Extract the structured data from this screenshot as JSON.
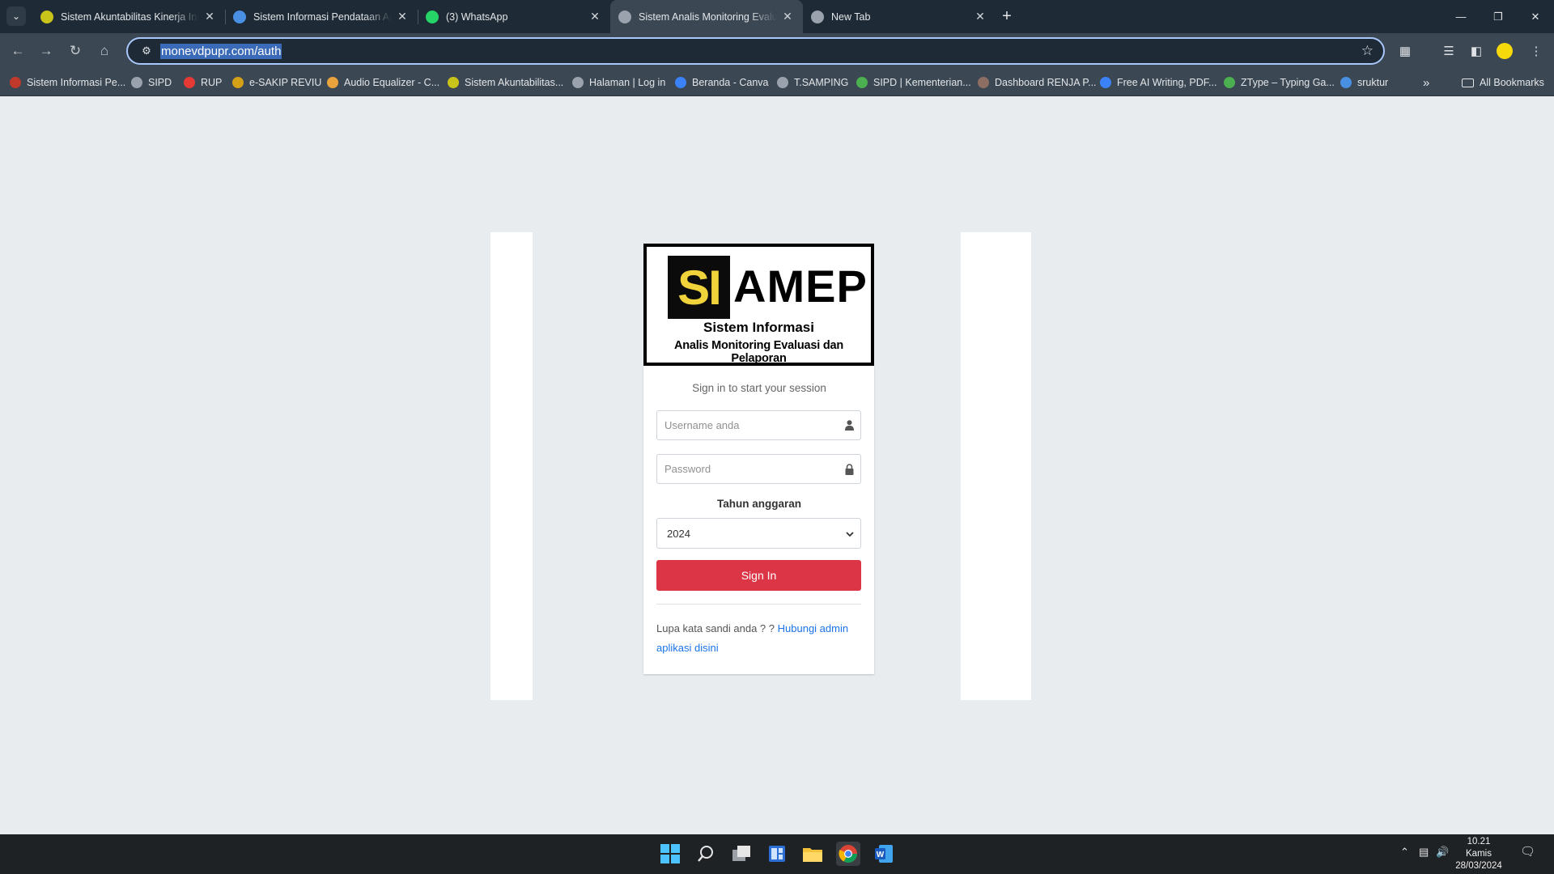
{
  "browser": {
    "tabs": [
      {
        "title": "Sistem Akuntabilitas Kinerja Ins",
        "active": false,
        "favicon_color": "#c9c41a"
      },
      {
        "title": "Sistem Informasi Pendataan Ap",
        "active": false,
        "favicon_color": "#4a90e2"
      },
      {
        "title": "(3) WhatsApp",
        "active": false,
        "favicon_color": "#25d366"
      },
      {
        "title": "Sistem Analis Monitoring Evalu",
        "active": true,
        "favicon_color": "#9aa3ad"
      },
      {
        "title": "New Tab",
        "active": false,
        "favicon_color": "#9aa3ad"
      }
    ],
    "url": "monevdpupr.com/auth",
    "bookmarks": [
      {
        "label": "Sistem Informasi Pe...",
        "color": "#c0392b"
      },
      {
        "label": "SIPD",
        "color": "#9aa3ad"
      },
      {
        "label": "RUP",
        "color": "#e53935"
      },
      {
        "label": "e-SAKIP REVIU",
        "color": "#d4a017"
      },
      {
        "label": "Audio Equalizer - C...",
        "color": "#e8a33d"
      },
      {
        "label": "Sistem Akuntabilitas...",
        "color": "#c9c41a"
      },
      {
        "label": "Halaman | Log in",
        "color": "#9aa3ad"
      },
      {
        "label": "Beranda - Canva",
        "color": "#3b82f6"
      },
      {
        "label": "T.SAMPING",
        "color": "#9aa3ad"
      },
      {
        "label": "SIPD | Kementerian...",
        "color": "#4caf50"
      },
      {
        "label": "Dashboard RENJA P...",
        "color": "#8d6e63"
      },
      {
        "label": "Free AI Writing, PDF...",
        "color": "#3b82f6"
      },
      {
        "label": "ZType – Typing Ga...",
        "color": "#4caf50"
      },
      {
        "label": "sruktur",
        "color": "#4a90e2"
      }
    ],
    "all_bookmarks_label": "All Bookmarks"
  },
  "login": {
    "logo": {
      "si": "SI",
      "amep": "AMEP",
      "line1": "Sistem Informasi",
      "line2": "Analis Monitoring Evaluasi dan Pelaporan"
    },
    "message": "Sign in to start your session",
    "username_placeholder": "Username anda",
    "password_placeholder": "Password",
    "year_label": "Tahun anggaran",
    "year_value": "2024",
    "sign_in_label": "Sign In",
    "forgot_text": "Lupa kata sandi anda ? ?",
    "forgot_link": "Hubungi admin aplikasi disini"
  },
  "taskbar": {
    "time": "10.21",
    "day": "Kamis",
    "date": "28/03/2024"
  },
  "colors": {
    "accent_button": "#dc3545",
    "link": "#1a73e8",
    "logo_yellow": "#f0d23a"
  }
}
